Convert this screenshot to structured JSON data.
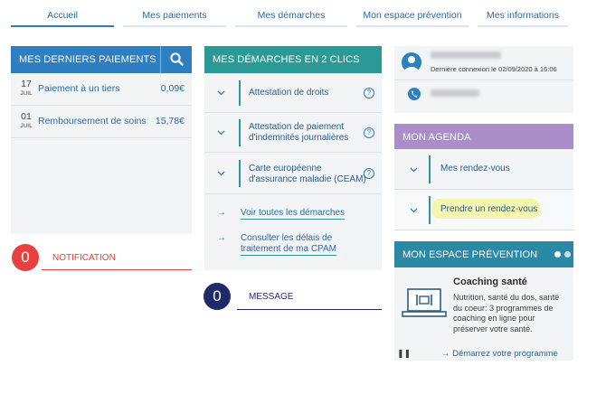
{
  "nav": {
    "tabs": [
      {
        "label": "Accueil",
        "active": true
      },
      {
        "label": "Mes paiements",
        "active": false
      },
      {
        "label": "Mes démarches",
        "active": false
      },
      {
        "label": "Mon espace prévention",
        "active": false
      },
      {
        "label": "Mes informations",
        "active": false
      }
    ]
  },
  "payments": {
    "title": "MES DERNIERS PAIEMENTS",
    "items": [
      {
        "day": "17",
        "month": "JUIL",
        "label": "Paiement à un tiers",
        "amount": "0,09€"
      },
      {
        "day": "01",
        "month": "JUIL",
        "label": "Remboursement de soins",
        "amount": "15,78€"
      }
    ]
  },
  "notification": {
    "count": "0",
    "label": "NOTIFICATION"
  },
  "demarches": {
    "title": "MES DÉMARCHES EN 2 CLICS",
    "items": [
      {
        "label_lines": [
          "Attestation de droits"
        ]
      },
      {
        "label_lines": [
          "Attestation de paiement",
          "d'indemnités journalières"
        ]
      },
      {
        "label_lines": [
          "Carte européenne",
          "d'assurance maladie (CEAM)"
        ]
      }
    ],
    "links": [
      {
        "lines": [
          "Voir toutes les démarches"
        ]
      },
      {
        "lines": [
          "Consulter les délais de",
          "traitement de ma CPAM"
        ]
      }
    ]
  },
  "message": {
    "count": "0",
    "label": "MESSAGE"
  },
  "profile": {
    "last_connection": "Dernière connexion le 02/09/2020 à 16:06"
  },
  "agenda": {
    "title": "MON AGENDA",
    "items": [
      {
        "label": "Mes rendez-vous"
      },
      {
        "label": "Prendre un rendez-vous",
        "highlighted": true
      }
    ]
  },
  "prevention": {
    "title": "MON ESPACE PRÉVENTION",
    "coaching_title": "Coaching santé",
    "coaching_desc": "Nutrition, santé du dos, santé du coeur: 3 programmes de coaching en ligne pour préserver votre santé.",
    "cta": "Démarrez votre programme"
  },
  "colors": {
    "blue": "#2e7ec2",
    "teal": "#2b9a96",
    "purple": "#a98ec9",
    "prevention": "#2a8aa6",
    "red": "#e84040",
    "navy": "#1f2a6b",
    "highlight": "#f6f75a"
  }
}
